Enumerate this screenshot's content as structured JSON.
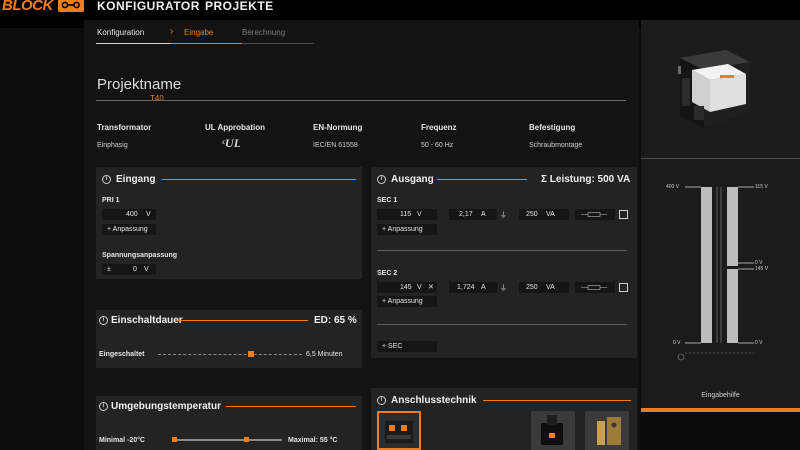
{
  "header": {
    "logo_text": "BLOCK",
    "nav": [
      "KONFIGURATOR",
      "PROJEKTE"
    ]
  },
  "breadcrumb": {
    "steps": [
      "Konfiguration",
      "Eingabe",
      "Berechnung"
    ],
    "active_step": "Eingabe"
  },
  "project": {
    "name_label": "Projektname",
    "name_value": "T40"
  },
  "specs": {
    "headers": [
      "Transformator",
      "UL Approbation",
      "EN-Normung",
      "Frequenz",
      "Befestigung"
    ],
    "values": [
      "Einphasig",
      "",
      "IEC/EN 61558",
      "50 - 60 Hz",
      "Schraubmontage"
    ],
    "ul_mark": "cULus"
  },
  "eingang": {
    "title": "Eingang",
    "pri_label": "PRI 1",
    "pri_value": "400",
    "pri_unit": "V",
    "anpassung_button": "+ Anpassung",
    "spannungs_label": "Spannungsanpassung",
    "spannungs_sign": "±",
    "spannungs_value": "0",
    "spannungs_unit": "V"
  },
  "ausgang": {
    "title": "Ausgang",
    "leistung": "Σ Leistung: 500 VA",
    "secs": [
      {
        "label": "SEC 1",
        "voltage": "115",
        "v_unit": "V",
        "has_close": false,
        "current": "2,17",
        "a_unit": "A",
        "power": "250",
        "va_unit": "VA",
        "anpassung": "+ Anpassung"
      },
      {
        "label": "SEC 2",
        "voltage": "145",
        "v_unit": "V",
        "has_close": true,
        "current": "1,724",
        "a_unit": "A",
        "power": "250",
        "va_unit": "VA",
        "anpassung": "+ Anpassung"
      }
    ],
    "add_sec_button": "+ SEC",
    "close_glyph": "✕"
  },
  "einschaltdauer": {
    "title": "Einschaltdauer",
    "ed_value": "ED: 65 %",
    "label": "Eingeschaltet",
    "slider_value": "6,5 Minuten",
    "slider_fraction": 0.65
  },
  "umgebung": {
    "title": "Umgebungstemperatur",
    "min_label": "Minimal -20°C",
    "max_label": "Maximal: 55 °C"
  },
  "anschluss": {
    "title": "Anschlusstechnik"
  },
  "sidebar": {
    "eingabehilfe": "Eingabehilfe",
    "diagram": {
      "left_top": "400 V",
      "left_bottom": "0 V",
      "right": [
        "115 V",
        "0 V",
        "145 V",
        "0 V"
      ]
    }
  },
  "colors": {
    "accent": "#ef7d1a",
    "background": "#131313",
    "panel": "#232323",
    "field": "#151515"
  },
  "icons": [
    "info-icon",
    "fuse-icon",
    "checkbox-icon",
    "ground-icon",
    "close-icon"
  ]
}
